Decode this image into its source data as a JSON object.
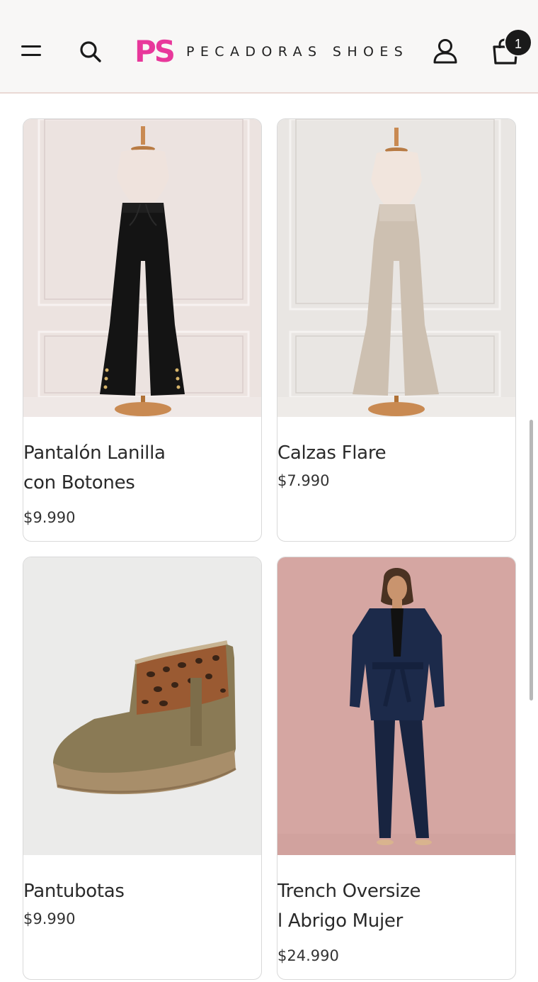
{
  "header": {
    "logo_mark": "PS",
    "logo_text": "PECADORAS SHOES",
    "cart_count": "1"
  },
  "products": [
    {
      "title_line1": "Pantalón Lanilla",
      "title_line2": "con Botones",
      "price": "$9.990"
    },
    {
      "title_line1": "Calzas Flare",
      "title_line2": "",
      "price": "$7.990"
    },
    {
      "title_line1": "Pantubotas",
      "title_line2": "",
      "price": "$9.990"
    },
    {
      "title_line1": "Trench Oversize",
      "title_line2": "l Abrigo Mujer",
      "price": "$24.990"
    }
  ],
  "colors": {
    "brand": "#e8389b",
    "header_bg": "#f8f7f6"
  }
}
